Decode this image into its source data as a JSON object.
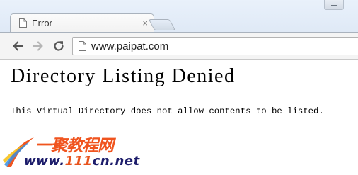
{
  "tab": {
    "title": "Error",
    "close_glyph": "×",
    "icon": "page-icon"
  },
  "toolbar": {
    "back_icon": "arrow-left-icon",
    "forward_icon": "arrow-right-icon",
    "reload_icon": "reload-icon",
    "url": "www.paipat.com"
  },
  "page": {
    "heading": "Directory Listing Denied",
    "message": "This Virtual Directory does not allow contents to be listed."
  },
  "watermark": {
    "brand_cn": "一聚教程网",
    "url_prefix": "www.",
    "url_number": "111",
    "url_suffix": "cn.net"
  },
  "colors": {
    "watermark_orange": "#f0541e",
    "watermark_navy": "#1d1d6b"
  }
}
